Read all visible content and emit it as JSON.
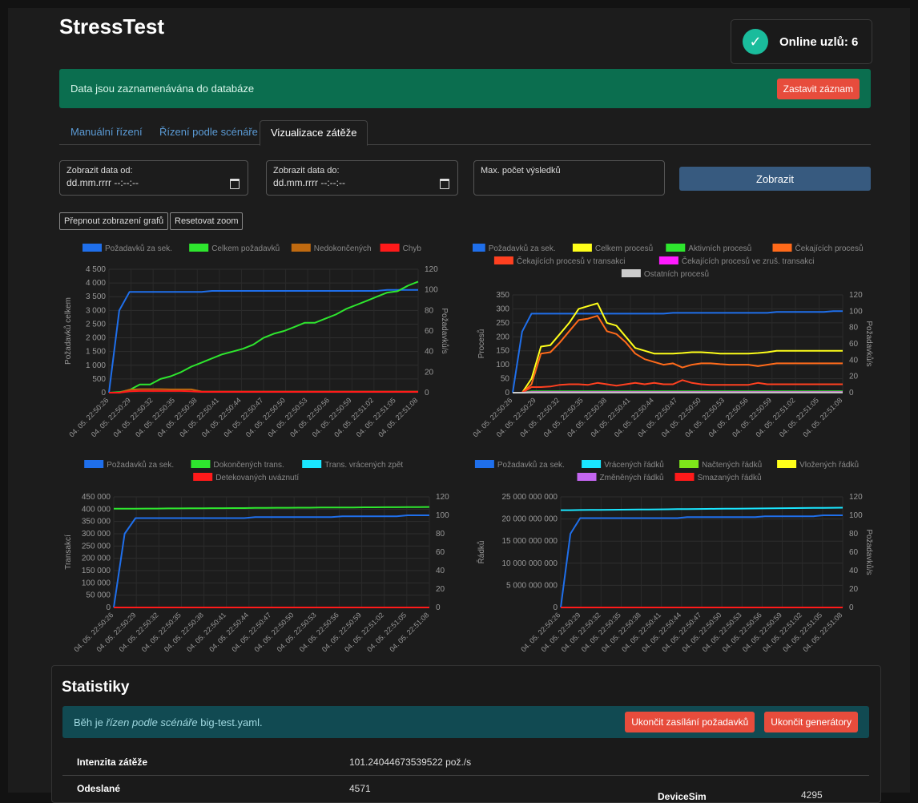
{
  "app": {
    "title": "StressTest"
  },
  "status": {
    "text": "Online uzlů: 6",
    "icon": "check-icon",
    "color": "#1abc9c"
  },
  "recording": {
    "message": "Data jsou zaznamenávána do databáze",
    "stop_label": "Zastavit záznam"
  },
  "tabs": [
    {
      "label": "Manuální řízení",
      "active": false
    },
    {
      "label": "Řízení podle scénáře",
      "active": false
    },
    {
      "label": "Vizualizace zátěže",
      "active": true
    }
  ],
  "filters": {
    "from_label": "Zobrazit data od:",
    "from_value": "dd.mm.rrrr --:--:--",
    "to_label": "Zobrazit data do:",
    "to_value": "dd.mm.rrrr --:--:--",
    "max_label": "Max. počet výsledků",
    "max_value": "",
    "show_label": "Zobrazit"
  },
  "chart_controls": {
    "toggle_label": "Přepnout zobrazení grafů",
    "reset_label": "Resetovat zoom"
  },
  "x_labels": [
    "04. 05. 22:50:26",
    "04. 05. 22:50:29",
    "04. 05. 22:50:32",
    "04. 05. 22:50:35",
    "04. 05. 22:50:38",
    "04. 05. 22:50:41",
    "04. 05. 22:50:44",
    "04. 05. 22:50:47",
    "04. 05. 22:50:50",
    "04. 05. 22:50:53",
    "04. 05. 22:50:56",
    "04. 05. 22:50:59",
    "04. 05. 22:51:02",
    "04. 05. 22:51:05",
    "04. 05. 22:51:08"
  ],
  "chart_data": [
    {
      "type": "line",
      "ylabel": "Požadavků celkem",
      "y2label": "Požadavků/s",
      "ylim": [
        0,
        4500
      ],
      "y2lim": [
        0,
        120
      ],
      "y_ticks": [
        "4 500",
        "4 000",
        "3 500",
        "3 000",
        "2 500",
        "2 000",
        "1 500",
        "1 000",
        "500",
        "0"
      ],
      "y2_ticks": [
        "120",
        "100",
        "80",
        "60",
        "40",
        "20",
        "0"
      ],
      "legend_placement": "top",
      "grid": true,
      "series": [
        {
          "name": "Požadavků za sek.",
          "color": "#1f6feb",
          "axis": "right",
          "values": [
            0,
            80,
            98,
            98,
            98,
            98,
            98,
            98,
            98,
            98,
            99,
            99,
            99,
            99,
            99,
            99,
            99,
            99,
            99,
            99,
            99,
            99,
            99,
            99,
            99,
            99,
            99,
            100,
            100,
            100,
            100
          ]
        },
        {
          "name": "Celkem požadavků",
          "color": "#2ee62e",
          "axis": "left",
          "values": [
            0,
            20,
            100,
            300,
            300,
            500,
            600,
            750,
            950,
            1100,
            1250,
            1400,
            1500,
            1600,
            1750,
            2000,
            2150,
            2250,
            2400,
            2550,
            2550,
            2700,
            2850,
            3050,
            3200,
            3350,
            3500,
            3650,
            3700,
            3900,
            4050
          ]
        },
        {
          "name": "Nedokončených",
          "color": "#c06a10",
          "axis": "left",
          "values": [
            0,
            0,
            110,
            130,
            130,
            130,
            120,
            120,
            120,
            40,
            40,
            40,
            40,
            40,
            40,
            40,
            40,
            40,
            40,
            40,
            40,
            40,
            40,
            40,
            40,
            40,
            40,
            40,
            40,
            40,
            40
          ]
        },
        {
          "name": "Chyb",
          "color": "#ff1a1a",
          "axis": "left",
          "values": [
            0,
            0,
            50,
            60,
            60,
            60,
            60,
            60,
            50,
            30,
            30,
            30,
            30,
            30,
            30,
            30,
            30,
            30,
            30,
            30,
            30,
            30,
            30,
            30,
            30,
            30,
            30,
            30,
            30,
            30,
            30
          ]
        }
      ]
    },
    {
      "type": "line",
      "ylabel": "Procesů",
      "y2label": "Požadavků/s",
      "ylim": [
        0,
        350
      ],
      "y2lim": [
        0,
        120
      ],
      "y_ticks": [
        "350",
        "300",
        "250",
        "200",
        "150",
        "100",
        "50",
        "0"
      ],
      "y2_ticks": [
        "120",
        "100",
        "80",
        "60",
        "40",
        "20",
        "0"
      ],
      "legend_placement": "top",
      "grid": true,
      "series": [
        {
          "name": "Požadavků za sek.",
          "color": "#1f6feb",
          "axis": "right",
          "values": [
            0,
            75,
            97,
            97,
            97,
            97,
            97,
            97,
            97,
            97,
            97,
            97,
            97,
            97,
            97,
            97,
            97,
            98,
            98,
            98,
            98,
            98,
            98,
            98,
            98,
            98,
            98,
            98,
            99,
            99,
            99,
            99,
            99,
            99,
            100,
            100
          ]
        },
        {
          "name": "Celkem procesů",
          "color": "#ffff1a",
          "axis": "left",
          "values": [
            0,
            0,
            50,
            165,
            170,
            210,
            250,
            300,
            310,
            320,
            250,
            240,
            200,
            160,
            150,
            140,
            140,
            140,
            142,
            145,
            145,
            143,
            140,
            140,
            140,
            140,
            142,
            145,
            150,
            150,
            150,
            150,
            150,
            150,
            150,
            150
          ]
        },
        {
          "name": "Aktivních procesů",
          "color": "#2ee62e",
          "axis": "left",
          "values": [
            0,
            0,
            5,
            5,
            5,
            5,
            5,
            5,
            5,
            5,
            5,
            5,
            5,
            5,
            5,
            5,
            5,
            5,
            5,
            5,
            5,
            5,
            5,
            5,
            5,
            5,
            5,
            5,
            5,
            5,
            5,
            5,
            5,
            5,
            5,
            5
          ]
        },
        {
          "name": "Čekajících procesů",
          "color": "#ff6a1a",
          "axis": "left",
          "values": [
            0,
            0,
            30,
            140,
            145,
            180,
            220,
            260,
            265,
            275,
            220,
            210,
            180,
            140,
            120,
            110,
            100,
            105,
            90,
            100,
            105,
            105,
            102,
            100,
            100,
            100,
            95,
            100,
            105,
            105,
            105,
            105,
            105,
            105,
            105,
            105
          ]
        },
        {
          "name": "Čekajících procesů v transakci",
          "color": "#ff4020",
          "axis": "left",
          "values": [
            0,
            0,
            20,
            20,
            22,
            28,
            30,
            30,
            28,
            35,
            30,
            25,
            30,
            35,
            30,
            35,
            30,
            30,
            45,
            35,
            30,
            28,
            28,
            28,
            28,
            28,
            35,
            30,
            30,
            30,
            30,
            30,
            30,
            30,
            30,
            30
          ]
        },
        {
          "name": "Čekajících procesů ve zruš. transakci",
          "color": "#ff1aff",
          "axis": "left",
          "values": [
            0,
            0,
            2,
            2,
            2,
            2,
            2,
            2,
            2,
            2,
            2,
            2,
            2,
            2,
            2,
            2,
            2,
            2,
            2,
            2,
            2,
            2,
            2,
            2,
            2,
            2,
            2,
            2,
            2,
            2,
            2,
            2,
            2,
            2,
            2,
            2
          ]
        },
        {
          "name": "Ostatních procesů",
          "color": "#cccccc",
          "axis": "left",
          "values": [
            0,
            0,
            1,
            1,
            1,
            1,
            1,
            1,
            1,
            1,
            1,
            1,
            1,
            1,
            1,
            1,
            1,
            1,
            1,
            1,
            1,
            1,
            1,
            1,
            1,
            1,
            1,
            1,
            1,
            1,
            1,
            1,
            1,
            1,
            1,
            1
          ]
        }
      ]
    },
    {
      "type": "line",
      "ylabel": "Transakcí",
      "y2label": "Požadavků/s",
      "ylim": [
        0,
        450000
      ],
      "y2lim": [
        0,
        120
      ],
      "y_ticks": [
        "450 000",
        "400 000",
        "350 000",
        "300 000",
        "250 000",
        "200 000",
        "150 000",
        "100 000",
        "50 000",
        "0"
      ],
      "y2_ticks": [
        "120",
        "100",
        "80",
        "60",
        "40",
        "20",
        "0"
      ],
      "legend_placement": "top",
      "grid": true,
      "series": [
        {
          "name": "Požadavků za sek.",
          "color": "#1f6feb",
          "axis": "right",
          "values": [
            0,
            80,
            97,
            97,
            97,
            97,
            97,
            97,
            97,
            97,
            97,
            97,
            97,
            98,
            98,
            98,
            98,
            98,
            98,
            98,
            98,
            99,
            99,
            99,
            99,
            99,
            99,
            100,
            100,
            100
          ]
        },
        {
          "name": "Dokončených trans.",
          "color": "#2ee62e",
          "axis": "left",
          "values": [
            402000,
            402000,
            402000,
            402500,
            402500,
            403000,
            403000,
            403500,
            403500,
            404000,
            404000,
            404500,
            404500,
            405000,
            405000,
            405500,
            405500,
            406000,
            406000,
            406500,
            406500,
            407000,
            407000,
            407500,
            407500,
            408000,
            408000,
            408500,
            408500,
            409000
          ]
        },
        {
          "name": "Trans. vrácených zpět",
          "color": "#1ae6ff",
          "axis": "left",
          "values": [
            0,
            0,
            0,
            0,
            0,
            0,
            0,
            0,
            0,
            0,
            0,
            0,
            0,
            0,
            0,
            0,
            0,
            0,
            0,
            0,
            0,
            0,
            0,
            0,
            0,
            0,
            0,
            0,
            0,
            0
          ]
        },
        {
          "name": "Detekovaných uváznutí",
          "color": "#ff1a1a",
          "axis": "left",
          "values": [
            0,
            0,
            0,
            0,
            0,
            0,
            0,
            0,
            0,
            0,
            0,
            0,
            0,
            0,
            0,
            0,
            0,
            0,
            0,
            0,
            0,
            0,
            0,
            0,
            0,
            0,
            0,
            0,
            0,
            0
          ]
        }
      ]
    },
    {
      "type": "line",
      "ylabel": "Řádků",
      "y2label": "Požadavků/s",
      "ylim": [
        0,
        25000000000
      ],
      "y2lim": [
        0,
        120
      ],
      "y_ticks": [
        "25 000 000 000",
        "20 000 000 000",
        "15 000 000 000",
        "10 000 000 000",
        "5 000 000 000",
        "0"
      ],
      "y2_ticks": [
        "120",
        "100",
        "80",
        "60",
        "40",
        "20",
        "0"
      ],
      "legend_placement": "top",
      "grid": true,
      "series": [
        {
          "name": "Požadavků za sek.",
          "color": "#1f6feb",
          "axis": "right",
          "values": [
            0,
            80,
            97,
            97,
            97,
            97,
            97,
            97,
            97,
            97,
            97,
            97,
            97,
            98,
            98,
            98,
            98,
            98,
            98,
            98,
            98,
            99,
            99,
            99,
            99,
            99,
            99,
            100,
            100,
            100
          ]
        },
        {
          "name": "Vrácených řádků",
          "color": "#1ae6ff",
          "axis": "left",
          "values": [
            22000000000,
            22000000000,
            22020000000,
            22040000000,
            22060000000,
            22080000000,
            22100000000,
            22120000000,
            22140000000,
            22160000000,
            22180000000,
            22200000000,
            22220000000,
            22240000000,
            22260000000,
            22280000000,
            22300000000,
            22320000000,
            22340000000,
            22360000000,
            22380000000,
            22400000000,
            22420000000,
            22440000000,
            22460000000,
            22480000000,
            22500000000,
            22520000000,
            22540000000,
            22560000000
          ]
        },
        {
          "name": "Načtených řádků",
          "color": "#7ee61a",
          "axis": "left",
          "values": [
            0,
            0,
            0,
            0,
            0,
            0,
            0,
            0,
            0,
            0,
            0,
            0,
            0,
            0,
            0,
            0,
            0,
            0,
            0,
            0,
            0,
            0,
            0,
            0,
            0,
            0,
            0,
            0,
            0,
            0
          ]
        },
        {
          "name": "Vložených řádků",
          "color": "#ffff1a",
          "axis": "left",
          "values": [
            0,
            0,
            0,
            0,
            0,
            0,
            0,
            0,
            0,
            0,
            0,
            0,
            0,
            0,
            0,
            0,
            0,
            0,
            0,
            0,
            0,
            0,
            0,
            0,
            0,
            0,
            0,
            0,
            0,
            0
          ]
        },
        {
          "name": "Změněných řádků",
          "color": "#c466f0",
          "axis": "left",
          "values": [
            0,
            0,
            0,
            0,
            0,
            0,
            0,
            0,
            0,
            0,
            0,
            0,
            0,
            0,
            0,
            0,
            0,
            0,
            0,
            0,
            0,
            0,
            0,
            0,
            0,
            0,
            0,
            0,
            0,
            0
          ]
        },
        {
          "name": "Smazaných řádků",
          "color": "#ff1a1a",
          "axis": "left",
          "values": [
            0,
            0,
            0,
            0,
            0,
            0,
            0,
            0,
            0,
            0,
            0,
            0,
            0,
            0,
            0,
            0,
            0,
            0,
            0,
            0,
            0,
            0,
            0,
            0,
            0,
            0,
            0,
            0,
            0,
            0
          ]
        }
      ]
    }
  ],
  "stats": {
    "title": "Statistiky",
    "run_prefix": "Běh je ",
    "run_italic": "řízen podle scénáře",
    "run_suffix": " big-test.yaml.",
    "stop_requests_label": "Ukončit zasílání požadavků",
    "stop_generators_label": "Ukončit generátory",
    "rows": [
      {
        "key": "Intenzita zátěže",
        "value": "101.24044673539522 pož./s"
      },
      {
        "key": "Odeslané",
        "value": "4571",
        "key2": "DeviceSim",
        "value2": "4295"
      }
    ]
  }
}
